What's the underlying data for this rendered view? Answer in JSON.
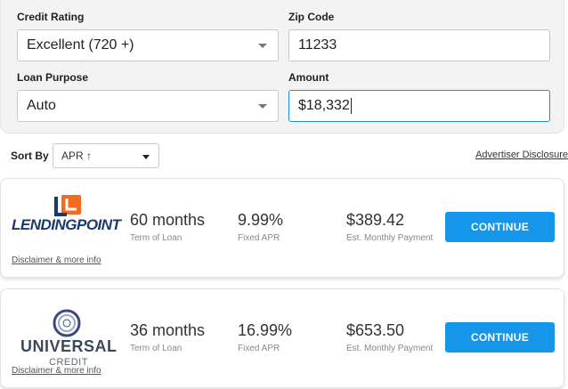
{
  "filters": {
    "credit_rating": {
      "label": "Credit Rating",
      "value": "Excellent (720 +)"
    },
    "zip_code": {
      "label": "Zip Code",
      "value": "11233"
    },
    "loan_purpose": {
      "label": "Loan Purpose",
      "value": "Auto"
    },
    "amount": {
      "label": "Amount",
      "value": "$18,332"
    }
  },
  "sort": {
    "label": "Sort By",
    "value": "APR ↑"
  },
  "advertiser_disclosure": "Advertiser Disclosure",
  "offers": [
    {
      "lender": {
        "name": "LENDINGPOINT",
        "logo_mark": "LP"
      },
      "term": "60 months",
      "term_label": "Term of Loan",
      "apr": "9.99%",
      "apr_label": "Fixed APR",
      "payment": "$389.42",
      "payment_label": "Est. Monthly Payment",
      "cta": "CONTINUE",
      "disclaimer": "Disclaimer & more info"
    },
    {
      "lender": {
        "name_line1": "UNIVERSAL",
        "name_line2": "CREDIT"
      },
      "term": "36 months",
      "term_label": "Term of Loan",
      "apr": "16.99%",
      "apr_label": "Fixed APR",
      "payment": "$653.50",
      "payment_label": "Est. Monthly Payment",
      "cta": "CONTINUE",
      "disclaimer": "Disclaimer & more info"
    }
  ],
  "colors": {
    "accent": "#1596ea",
    "lendingpoint_orange": "#f26b21",
    "lendingpoint_navy": "#1a3a6b"
  }
}
